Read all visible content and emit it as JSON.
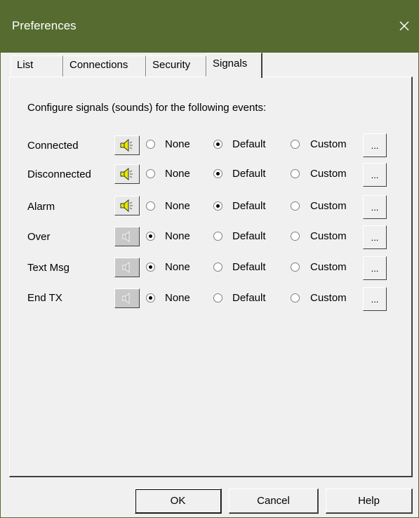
{
  "window": {
    "title": "Preferences"
  },
  "tabs": [
    "List",
    "Connections",
    "Security",
    "Signals"
  ],
  "active_tab": "Signals",
  "intro": "Configure signals (sounds) for the following events:",
  "options": {
    "none": "None",
    "default": "Default",
    "custom": "Custom",
    "browse": "..."
  },
  "events": [
    {
      "label": "Connected",
      "selected": "Default",
      "sound_enabled": true
    },
    {
      "label": "Disconnected",
      "selected": "Default",
      "sound_enabled": true
    },
    {
      "label": "Alarm",
      "selected": "Default",
      "sound_enabled": true
    },
    {
      "label": "Over",
      "selected": "None",
      "sound_enabled": false
    },
    {
      "label": "Text Msg",
      "selected": "None",
      "sound_enabled": false
    },
    {
      "label": "End TX",
      "selected": "None",
      "sound_enabled": false
    }
  ],
  "buttons": {
    "ok": "OK",
    "cancel": "Cancel",
    "help": "Help"
  },
  "colors": {
    "titlebar": "#556b2f",
    "speaker_on": "#e8e800"
  }
}
